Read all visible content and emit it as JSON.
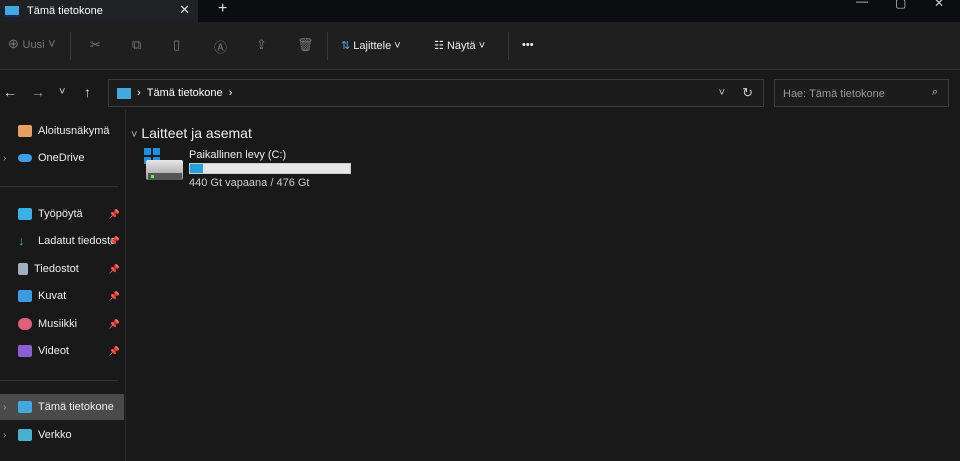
{
  "tab": {
    "title": "Tämä tietokone",
    "close": "✕",
    "new": "+"
  },
  "toolbar": {
    "new_label": "Uusi",
    "sort_label": "Lajittele",
    "view_label": "Näytä",
    "more": "•••"
  },
  "address": {
    "path": "Tämä tietokone",
    "search_placeholder": "Hae: Tämä tietokone"
  },
  "sidebar": {
    "items": [
      {
        "label": "Aloitusnäkymä"
      },
      {
        "label": "OneDrive"
      },
      {
        "label": "Työpöytä"
      },
      {
        "label": "Ladatut tiedostot"
      },
      {
        "label": "Tiedostot"
      },
      {
        "label": "Kuvat"
      },
      {
        "label": "Musiikki"
      },
      {
        "label": "Videot"
      },
      {
        "label": "Tämä tietokone"
      },
      {
        "label": "Verkko"
      }
    ]
  },
  "content": {
    "group": "Laitteet ja asemat",
    "drive": {
      "name": "Paikallinen levy (C:)",
      "space": "440 Gt vapaana / 476 Gt",
      "used_fraction": 0.076
    }
  },
  "colors": {
    "accent": "#26a0da",
    "selected": "#4a4a4a"
  }
}
